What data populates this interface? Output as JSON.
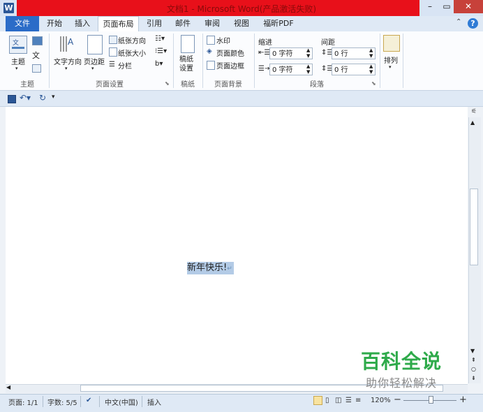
{
  "window": {
    "title": "文档1 - Microsoft Word(产品激活失败)",
    "logo_letter": "W",
    "min_glyph": "–",
    "max_glyph": "▭",
    "close_glyph": "✕"
  },
  "tabs": [
    {
      "label": "文件"
    },
    {
      "label": "开始"
    },
    {
      "label": "插入"
    },
    {
      "label": "页面布局"
    },
    {
      "label": "引用"
    },
    {
      "label": "邮件"
    },
    {
      "label": "审阅"
    },
    {
      "label": "视图"
    },
    {
      "label": "福昕PDF"
    }
  ],
  "help_glyph": "?",
  "ribbon": {
    "theme": {
      "themes_label": "主题",
      "group_label": "主题"
    },
    "page_setup": {
      "text_direction": "文字方向",
      "margins": "页边距",
      "orientation": "纸张方向",
      "size": "纸张大小",
      "columns": "分栏",
      "group_label": "页面设置"
    },
    "draft": {
      "draft_paper": "稿纸设置",
      "group_label": "稿纸"
    },
    "page_background": {
      "watermark": "水印",
      "page_color": "页面颜色",
      "page_borders": "页面边框",
      "group_label": "页面背景"
    },
    "paragraph": {
      "indent_label": "缩进",
      "spacing_label": "间距",
      "indent_left": "0 字符",
      "indent_right": "0 字符",
      "spacing_before": "0 行",
      "spacing_after": "0 行",
      "group_label": "段落"
    },
    "arrange": {
      "arrange_label": "排列"
    }
  },
  "document": {
    "selected_text": "新年快乐!",
    "paragraph_mark": "↵"
  },
  "watermark": {
    "title": "百科全说",
    "subtitle": "助你轻松解决"
  },
  "status": {
    "page": "页面: 1/1",
    "words": "字数: 5/5",
    "language": "中文(中国)",
    "insert_mode": "插入",
    "zoom": "120%",
    "zoom_minus": "−",
    "zoom_plus": "+"
  }
}
